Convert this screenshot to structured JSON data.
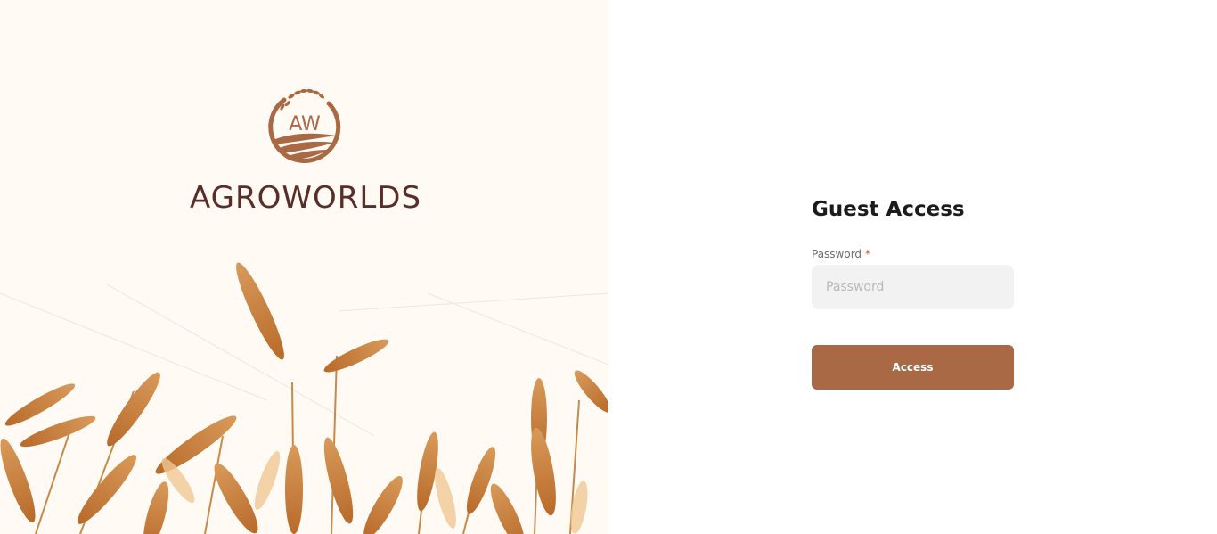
{
  "brand": {
    "name": "AGROWORLDS",
    "logo_initials": "AW",
    "logo_color": "#a96945",
    "name_color": "#5a2d28"
  },
  "hero": {
    "image": "wheat-field"
  },
  "form": {
    "title": "Guest Access",
    "password_label": "Password",
    "required_mark": "*",
    "password_placeholder": "Password",
    "password_value": "",
    "submit_label": "Access",
    "button_color": "#a96945"
  }
}
